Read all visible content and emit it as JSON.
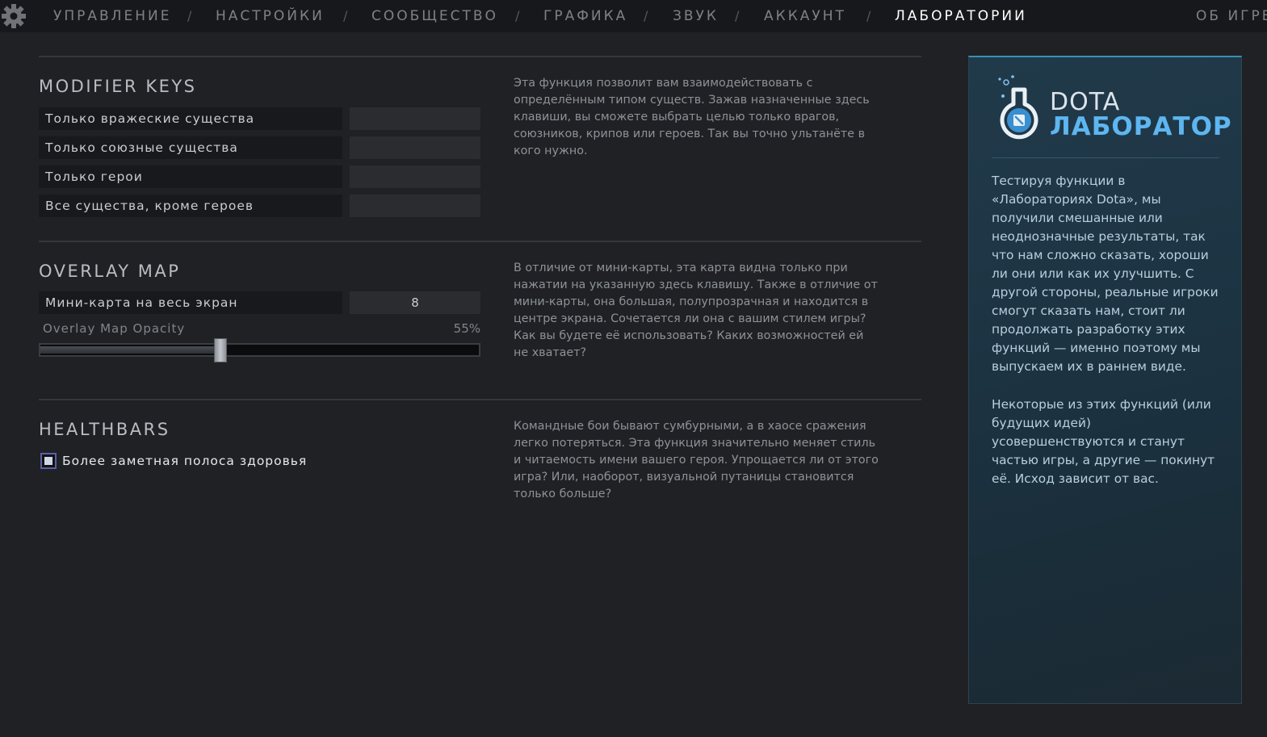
{
  "nav": {
    "items": [
      "УПРАВЛЕНИЕ",
      "НАСТРОЙКИ",
      "СООБЩЕСТВО",
      "ГРАФИКА",
      "ЗВУК",
      "АККАУНТ",
      "ЛАБОРАТОРИИ"
    ],
    "active": "ЛАБОРАТОРИИ",
    "about": "ОБ ИГРЕ",
    "separator": "/"
  },
  "modifier_keys": {
    "title": "MODIFIER KEYS",
    "rows": [
      {
        "label": "Только вражеские существа",
        "bind": ""
      },
      {
        "label": "Только союзные существа",
        "bind": ""
      },
      {
        "label": "Только герои",
        "bind": ""
      },
      {
        "label": "Все существа, кроме героев",
        "bind": ""
      }
    ],
    "description": "Эта функция позволит вам взаимодействовать с определённым типом существ. Зажав назначенные здесь клавиши, вы сможете выбрать целью только врагов, союзников, крипов или героев. Так вы точно ультанёте в кого нужно."
  },
  "overlay_map": {
    "title": "OVERLAY MAP",
    "row_label": "Мини-карта на весь экран",
    "row_bind": "8",
    "slider_label": "Overlay Map Opacity",
    "slider_value_text": "55%",
    "slider_value": 0.41,
    "description": "В отличие от мини-карты, эта карта видна только при нажатии на указанную здесь клавишу. Также в отличие от мини-карты, она большая, полупрозрачная и находится в центре экрана. Сочетается ли она с вашим стилем игры? Как вы будете её использовать? Каких возможностей ей не хватает?"
  },
  "healthbars": {
    "title": "HEALTHBARS",
    "checkbox_label": "Более заметная полоса здоровья",
    "checked": true,
    "description": "Командные бои бывают сумбурными, а в хаосе сражения легко потеряться. Эта функция значительно меняет стиль и читаемость имени вашего героя. Упрощается ли от этого игра? Или, наоборот, визуальной путаницы становится только больше?"
  },
  "lab_panel": {
    "logo_top": "DOTA",
    "logo_bottom": "ЛАБОРАТОР",
    "paragraph1": "Тестируя функции в «Лабораториях Dota», мы получили смешанные или неоднозначные результаты, так что нам сложно сказать, хороши ли они или как их улучшить. С другой стороны, реальные игроки смогут сказать нам, стоит ли продолжать разработку этих функций — именно поэтому мы выпускаем их в раннем виде.",
    "paragraph2": "Некоторые из этих функций (или будущих идей) усовершенствуются и станут частью игры, а другие — покинут её. Исход зависит от вас.",
    "accent_color": "#5db6f0"
  }
}
